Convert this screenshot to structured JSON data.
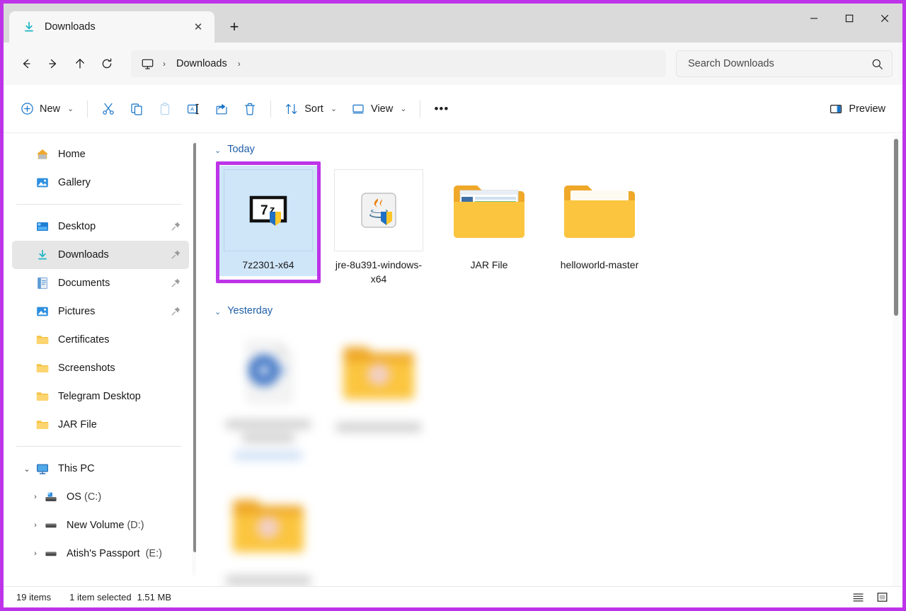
{
  "window": {
    "annotation_color": "#bd34e8",
    "controls": {
      "minimize": "–",
      "maximize": "□",
      "close": "✕"
    }
  },
  "tabs": {
    "items": [
      {
        "label": "Downloads",
        "icon": "download-icon",
        "close": "✕"
      }
    ],
    "new_tab_label": "+"
  },
  "navbar": {
    "back": "←",
    "forward": "→",
    "up": "↑",
    "refresh": "⟳",
    "breadcrumb": {
      "root_icon": "this-pc-monitor-icon",
      "separator": "›",
      "items": [
        "Downloads"
      ]
    },
    "search": {
      "placeholder": "Search Downloads",
      "value": "",
      "icon": "search-icon"
    }
  },
  "toolbar": {
    "new_label": "New",
    "new_chevron": "⌄",
    "cut_label": "Cut",
    "copy_label": "Copy",
    "paste_label": "Paste",
    "rename_label": "Rename",
    "share_label": "Share",
    "delete_label": "Delete",
    "sort_label": "Sort",
    "sort_chevron": "⌄",
    "view_label": "View",
    "view_chevron": "⌄",
    "more_label": "•••",
    "preview_label": "Preview"
  },
  "sidebar": {
    "quick": [
      {
        "label": "Home",
        "icon": "home-icon",
        "pinned": false,
        "selected": false
      },
      {
        "label": "Gallery",
        "icon": "gallery-icon",
        "pinned": false,
        "selected": false
      }
    ],
    "pinned": [
      {
        "label": "Desktop",
        "icon": "desktop-icon",
        "pinned": true,
        "selected": false
      },
      {
        "label": "Downloads",
        "icon": "download-icon",
        "pinned": true,
        "selected": true
      },
      {
        "label": "Documents",
        "icon": "documents-icon",
        "pinned": true,
        "selected": false
      },
      {
        "label": "Pictures",
        "icon": "pictures-icon",
        "pinned": true,
        "selected": false
      },
      {
        "label": "Certificates",
        "icon": "folder-icon",
        "pinned": false,
        "selected": false
      },
      {
        "label": "Screenshots",
        "icon": "folder-icon",
        "pinned": false,
        "selected": false
      },
      {
        "label": "Telegram Desktop",
        "icon": "folder-icon",
        "pinned": false,
        "selected": false
      },
      {
        "label": "JAR File",
        "icon": "folder-icon",
        "pinned": false,
        "selected": false
      }
    ],
    "thispc": {
      "label": "This PC",
      "icon": "this-pc-icon",
      "expanded": true,
      "chevron": "⌄",
      "drives": [
        {
          "name": "OS",
          "letter": "(C:)",
          "icon": "system-drive-icon",
          "chevron": "›"
        },
        {
          "name": "New Volume",
          "letter": "(D:)",
          "icon": "drive-icon",
          "chevron": "›"
        },
        {
          "name": "Atish's Passport",
          "letter": "(E:)",
          "icon": "drive-icon",
          "chevron": "›"
        }
      ]
    }
  },
  "content": {
    "groups": [
      {
        "header": "Today",
        "chevron": "⌄",
        "items": [
          {
            "label": "7z2301-x64",
            "icon": "sevenzip-installer-icon",
            "selected": true,
            "annotated": true,
            "framed": true,
            "blurred": false
          },
          {
            "label": "jre-8u391-windows-x64",
            "icon": "java-installer-icon",
            "selected": false,
            "annotated": false,
            "framed": true,
            "blurred": false
          },
          {
            "label": "JAR File",
            "icon": "folder-with-preview-icon",
            "selected": false,
            "annotated": false,
            "framed": false,
            "blurred": false
          },
          {
            "label": "helloworld-master",
            "icon": "folder-icon",
            "selected": false,
            "annotated": false,
            "framed": false,
            "blurred": false
          }
        ]
      },
      {
        "header": "Yesterday",
        "chevron": "⌄",
        "items": [
          {
            "label": "",
            "icon": "blurred-file-icon",
            "selected": false,
            "annotated": false,
            "framed": false,
            "blurred": true
          },
          {
            "label": "",
            "icon": "blurred-folder-icon",
            "selected": false,
            "annotated": false,
            "framed": false,
            "blurred": true
          },
          {
            "label": "",
            "icon": "blurred-folder-icon",
            "selected": false,
            "annotated": false,
            "framed": false,
            "blurred": true
          }
        ]
      }
    ]
  },
  "statusbar": {
    "item_count": "19 items",
    "selection": "1 item selected",
    "size": "1.51 MB",
    "list_view_icon": "list-view-icon",
    "grid_view_icon": "large-icons-view-icon"
  }
}
